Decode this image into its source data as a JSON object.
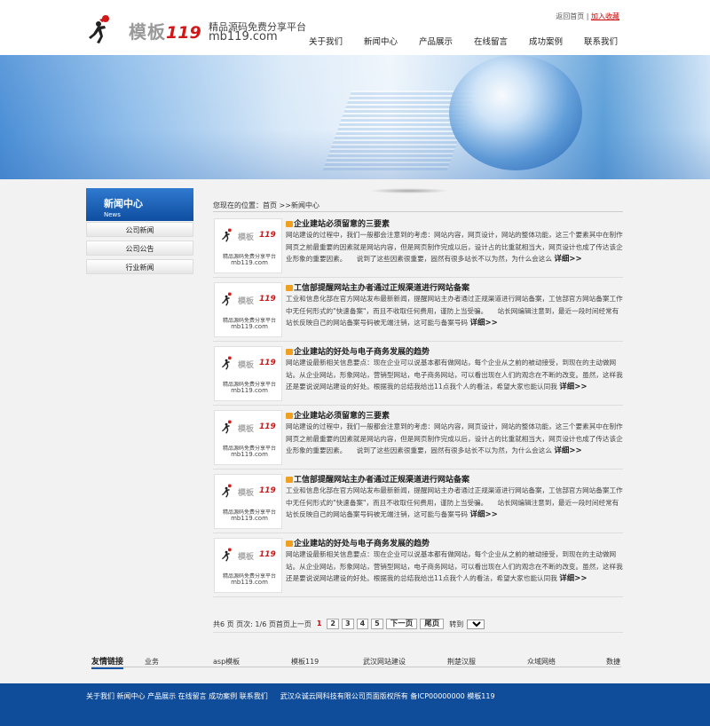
{
  "header": {
    "logo_name": "模板",
    "logo_number": "119",
    "tagline": "精品源码免费分享平台",
    "url": "mb119.com",
    "home_link": "返回首页",
    "separator": "|",
    "favorite_link": "加入收藏"
  },
  "nav": [
    "关于我们",
    "新闻中心",
    "产品展示",
    "在线留言",
    "成功案例",
    "联系我们"
  ],
  "sidebar": {
    "title": "新闻中心",
    "subtitle": "News",
    "items": [
      "公司新闻",
      "公司公告",
      "行业新闻"
    ]
  },
  "breadcrumb": "您现在的位置：首页 >>新闻中心",
  "news": [
    {
      "title": "企业建站必须留意的三要素",
      "desc": "网站建设的过程中，我们一般都会注意到的考虑：网站内容，网页设计，网站的整体功能，这三个要素其中在制作网页之前最重要的因素就是网站内容，但是网页制作完成以后，设计占的比重就相当大，网页设计也成了传达该企业形象的重要因素。　　说到了这些因素很重要，固然有很多站长不以为然，为什么会这么",
      "more": "详细>>"
    },
    {
      "title": "工信部提醒网站主办者通过正规渠道进行网站备案",
      "desc": "工业和信息化部在官方网站发布最新新闻，提醒网站主办者通过正规渠道进行网站备案，工信部官方网站备案工作中无任何形式的\"快速备案\"，而且不收取任何费用，谨防上当受骗。　　站长网编辑注意到，最近一段时间经常有站长反映自己的网站备案号码被无端注销，这可能与备案号码",
      "more": "详细>>"
    },
    {
      "title": "企业建站的好处与电子商务发展的趋势",
      "desc": "网站建设最新相关信息要点：现在企业可以说基本都有做网站，每个企业从之前的被动接受，到现在的主动做网站。从企业网站，形象网站，营销型网站，电子商务网站，可以看出现在人们的观念在不断的改变。虽然，这样我还是要说说网站建设的好处。根据我的总结我给出11点我个人的看法，希望大家也能认同我",
      "more": "详细>>"
    },
    {
      "title": "企业建站必须留意的三要素",
      "desc": "网站建设的过程中，我们一般都会注意到的考虑：网站内容，网页设计，网站的整体功能，这三个要素其中在制作网页之前最重要的因素就是网站内容，但是网页制作完成以后，设计占的比重就相当大，网页设计也成了传达该企业形象的重要因素。　　说到了这些因素很重要，固然有很多站长不以为然，为什么会这么",
      "more": "详细>>"
    },
    {
      "title": "工信部提醒网站主办者通过正规渠道进行网站备案",
      "desc": "工业和信息化部在官方网站发布最新新闻，提醒网站主办者通过正规渠道进行网站备案，工信部官方网站备案工作中无任何形式的\"快速备案\"，而且不收取任何费用，谨防上当受骗。　　站长网编辑注意到，最近一段时间经常有站长反映自己的网站备案号码被无端注销，这可能与备案号码",
      "more": "详细>>"
    },
    {
      "title": "企业建站的好处与电子商务发展的趋势",
      "desc": "网站建设最新相关信息要点：现在企业可以说基本都有做网站，每个企业从之前的被动接受，到现在的主动做网站。从企业网站，形象网站，营销型网站，电子商务网站，可以看出现在人们的观念在不断的改变。虽然，这样我还是要说说网站建设的好处。根据我的总结我给出11点我个人的看法，希望大家也能认同我",
      "more": "详细>>"
    }
  ],
  "pager": {
    "summary": "共6 页 页次: 1/6 页首页上一页",
    "pages": [
      "1",
      "2",
      "3",
      "4",
      "5"
    ],
    "next": "下一页",
    "last": "尾页",
    "goto": "转到",
    "selected": "1"
  },
  "links": {
    "title": "友情链接",
    "items": [
      "业务",
      "asp模板",
      "模板119",
      "武汉网站建设",
      "荆楚汉服",
      "众域网络",
      "数捷"
    ]
  },
  "footer": {
    "nav": "关于我们  新闻中心  产品展示  在线留言  成功案例  联系我们",
    "copyright": "武汉众诚云网科技有限公司页面版权所有  备ICP00000000   模板119"
  },
  "colors": {
    "brand_blue": "#0f4c99",
    "accent_red": "#d01818",
    "title_icon": "#f0a020"
  }
}
